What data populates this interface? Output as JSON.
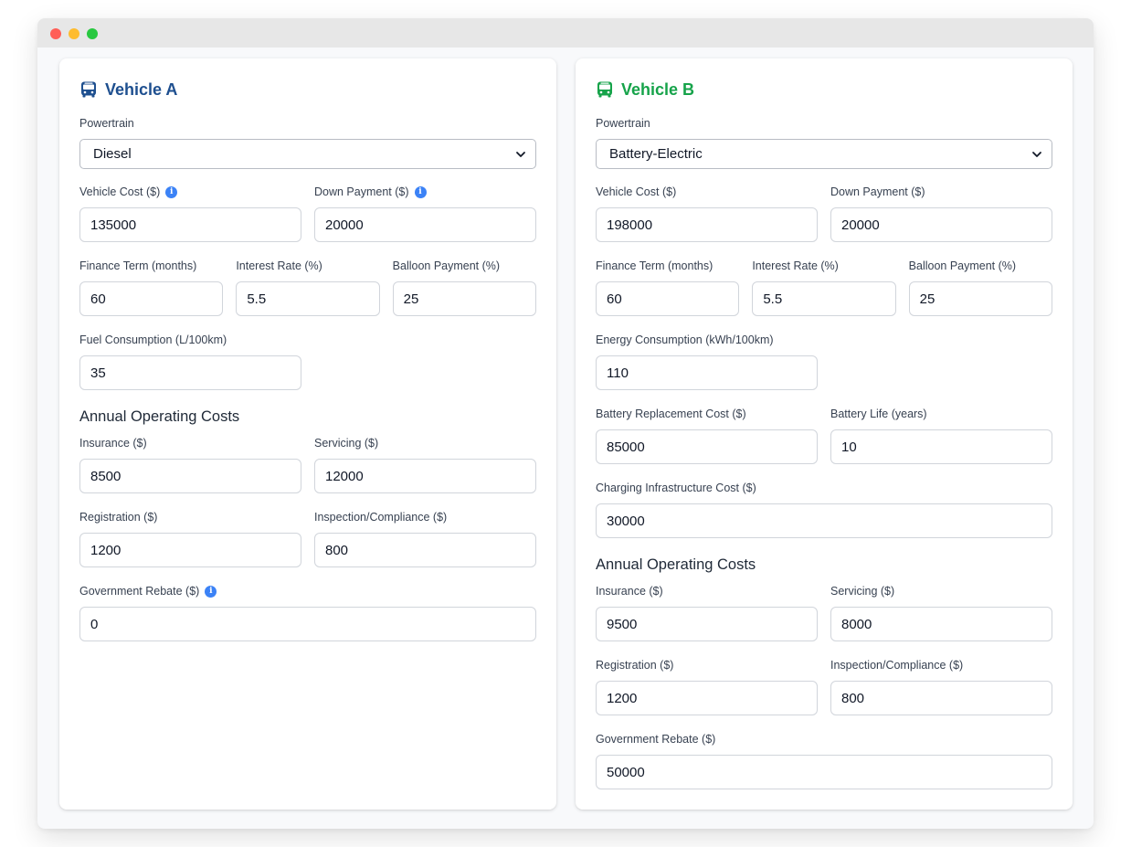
{
  "vehicle_a": {
    "title": "Vehicle A",
    "accent": "#1e4f8f",
    "icon": "bus-icon",
    "powertrain_label": "Powertrain",
    "powertrain_value": "Diesel",
    "vehicle_cost_label": "Vehicle Cost ($)",
    "vehicle_cost": "135000",
    "down_payment_label": "Down Payment ($)",
    "down_payment": "20000",
    "finance_term_label": "Finance Term (months)",
    "finance_term": "60",
    "interest_rate_label": "Interest Rate (%)",
    "interest_rate": "5.5",
    "balloon_label": "Balloon Payment (%)",
    "balloon": "25",
    "consumption_label": "Fuel Consumption (L/100km)",
    "consumption": "35",
    "annual_title": "Annual Operating Costs",
    "insurance_label": "Insurance ($)",
    "insurance": "8500",
    "servicing_label": "Servicing ($)",
    "servicing": "12000",
    "registration_label": "Registration ($)",
    "registration": "1200",
    "inspection_label": "Inspection/Compliance ($)",
    "inspection": "800",
    "rebate_label": "Government Rebate ($)",
    "rebate": "0",
    "info_glyph": "i"
  },
  "vehicle_b": {
    "title": "Vehicle B",
    "accent": "#16a34a",
    "icon": "bus-icon",
    "powertrain_label": "Powertrain",
    "powertrain_value": "Battery-Electric",
    "vehicle_cost_label": "Vehicle Cost ($)",
    "vehicle_cost": "198000",
    "down_payment_label": "Down Payment ($)",
    "down_payment": "20000",
    "finance_term_label": "Finance Term (months)",
    "finance_term": "60",
    "interest_rate_label": "Interest Rate (%)",
    "interest_rate": "5.5",
    "balloon_label": "Balloon Payment (%)",
    "balloon": "25",
    "consumption_label": "Energy Consumption (kWh/100km)",
    "consumption": "110",
    "battery_cost_label": "Battery Replacement Cost ($)",
    "battery_cost": "85000",
    "battery_life_label": "Battery Life (years)",
    "battery_life": "10",
    "charging_label": "Charging Infrastructure Cost ($)",
    "charging": "30000",
    "annual_title": "Annual Operating Costs",
    "insurance_label": "Insurance ($)",
    "insurance": "9500",
    "servicing_label": "Servicing ($)",
    "servicing": "8000",
    "registration_label": "Registration ($)",
    "registration": "1200",
    "inspection_label": "Inspection/Compliance ($)",
    "inspection": "800",
    "rebate_label": "Government Rebate ($)",
    "rebate": "50000"
  },
  "window": {
    "controls": [
      "close",
      "minimize",
      "maximize"
    ]
  }
}
